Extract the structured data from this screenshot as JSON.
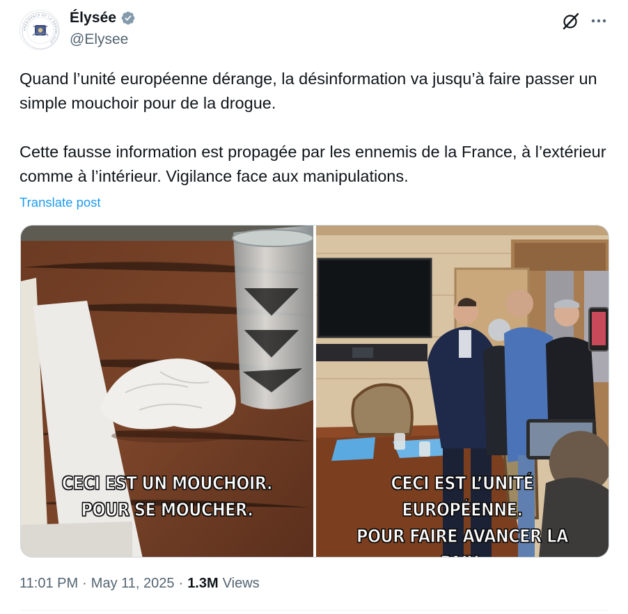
{
  "author": {
    "display_name": "Élysée",
    "handle": "@Elysee",
    "verified": true,
    "avatar_seal_text": "PRÉSIDENCE DE LA RÉPUBLIQUE"
  },
  "header_actions": {
    "grok_icon": "grok-icon",
    "more_icon": "more-icon"
  },
  "post": {
    "text": "Quand l’unité européenne dérange, la désinformation va jusqu’à faire passer un simple mouchoir pour de la drogue.\n\nCette fausse information est propagée par les ennemis de la France, à l’extérieur comme à l’intérieur. Vigilance face aux manipulations.",
    "translate_label": "Translate post"
  },
  "media": {
    "left": {
      "caption_line1": "CECI EST UN MOUCHOIR.",
      "caption_line2": "POUR SE MOUCHER."
    },
    "right": {
      "caption_line1": "CECI EST L’UNITÉ EUROPÉENNE.",
      "caption_line2": "POUR FAIRE AVANCER LA PAIX."
    }
  },
  "meta": {
    "time": "11:01 PM",
    "sep1": "·",
    "date": "May 11, 2025",
    "sep2": "·",
    "views_count": "1.3M",
    "views_label": "Views"
  },
  "colors": {
    "link": "#1d9bf0",
    "verified": "#829aab",
    "secondary_text": "#536471"
  }
}
